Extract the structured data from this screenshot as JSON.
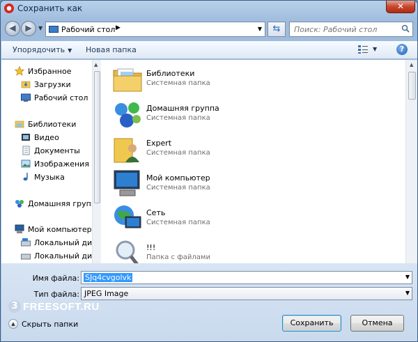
{
  "window": {
    "title": "Сохранить как",
    "close_label": "✕"
  },
  "address": {
    "location": "Рабочий стол",
    "search_placeholder": "Поиск: Рабочий стол"
  },
  "toolbar": {
    "organize": "Упорядочить",
    "new_folder": "Новая папка"
  },
  "nav": {
    "favorites": "Избранное",
    "downloads": "Загрузки",
    "desktop": "Рабочий стол",
    "libraries": "Библиотеки",
    "video": "Видео",
    "documents": "Документы",
    "images": "Изображения",
    "music": "Музыка",
    "homegroup": "Домашняя группа",
    "computer": "Мой компьютер",
    "local_disk_1": "Локальный диск",
    "local_disk_2": "Локальный диск"
  },
  "files": [
    {
      "name": "Библиотеки",
      "type": "Системная папка"
    },
    {
      "name": "Домашняя группа",
      "type": "Системная папка"
    },
    {
      "name": "Expert",
      "type": "Системная папка"
    },
    {
      "name": "Мой компьютер",
      "type": "Системная папка"
    },
    {
      "name": "Сеть",
      "type": "Системная папка"
    },
    {
      "name": "!!!",
      "type": "Папка с файлами"
    }
  ],
  "form": {
    "filename_label": "Имя файла:",
    "filename_value": "SJq4cvgolvk",
    "filetype_label": "Тип файла:",
    "filetype_value": "JPEG Image",
    "hide_folders": "Скрыть папки",
    "save": "Сохранить",
    "cancel": "Отмена"
  },
  "watermark": {
    "number": "3",
    "text": "FREESOFT.RU"
  }
}
